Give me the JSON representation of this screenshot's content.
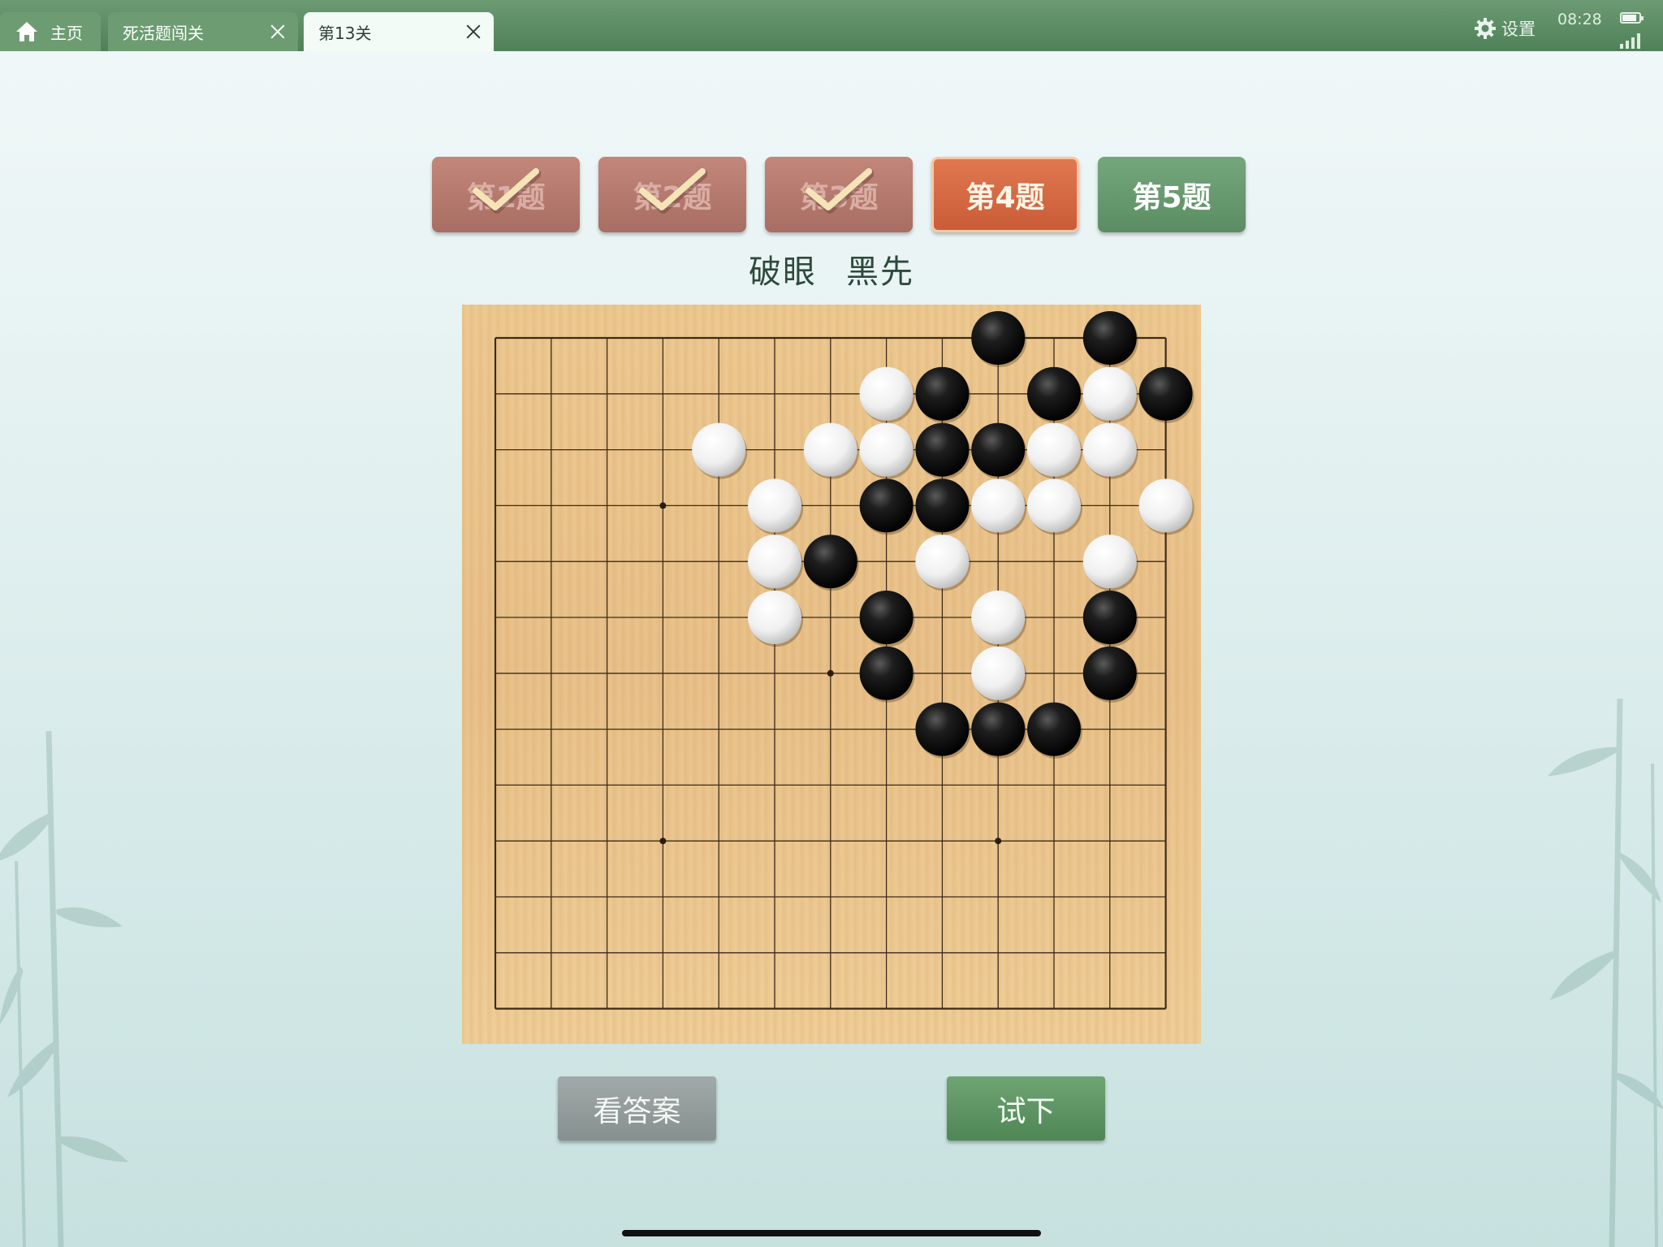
{
  "tabs": [
    {
      "label": "主页"
    },
    {
      "label": "死活题闯关"
    },
    {
      "label": "第13关"
    }
  ],
  "status": {
    "settings_label": "设置",
    "time": "08:28",
    "battery_level": 0.85,
    "signal_bars": 4
  },
  "problems": [
    {
      "label": "第1题",
      "state": "done"
    },
    {
      "label": "第2题",
      "state": "done"
    },
    {
      "label": "第3题",
      "state": "done"
    },
    {
      "label": "第4题",
      "state": "current"
    },
    {
      "label": "第5题",
      "state": "pending"
    }
  ],
  "task": {
    "type": "破眼",
    "to_play": "黑先"
  },
  "board": {
    "size": 13,
    "star_points": [
      [
        3,
        3
      ],
      [
        6,
        6
      ],
      [
        9,
        3
      ],
      [
        3,
        9
      ],
      [
        9,
        9
      ]
    ],
    "black": [
      [
        9,
        0
      ],
      [
        11,
        0
      ],
      [
        8,
        1
      ],
      [
        10,
        1
      ],
      [
        12,
        1
      ],
      [
        8,
        2
      ],
      [
        9,
        2
      ],
      [
        7,
        3
      ],
      [
        8,
        3
      ],
      [
        6,
        4
      ],
      [
        7,
        5
      ],
      [
        11,
        5
      ],
      [
        7,
        6
      ],
      [
        11,
        6
      ],
      [
        8,
        7
      ],
      [
        9,
        7
      ],
      [
        10,
        7
      ]
    ],
    "white": [
      [
        7,
        1
      ],
      [
        11,
        1
      ],
      [
        4,
        2
      ],
      [
        6,
        2
      ],
      [
        7,
        2
      ],
      [
        10,
        2
      ],
      [
        11,
        2
      ],
      [
        5,
        3
      ],
      [
        9,
        3
      ],
      [
        10,
        3
      ],
      [
        12,
        3
      ],
      [
        5,
        4
      ],
      [
        8,
        4
      ],
      [
        11,
        4
      ],
      [
        5,
        5
      ],
      [
        9,
        5
      ],
      [
        9,
        6
      ]
    ]
  },
  "actions": {
    "answer_label": "看答案",
    "try_label": "试下"
  },
  "colors": {
    "accent_green": "#5b8d63",
    "current_problem": "#d2643c",
    "done_problem": "#b57a6e",
    "board_wood": "#ebc48c"
  }
}
